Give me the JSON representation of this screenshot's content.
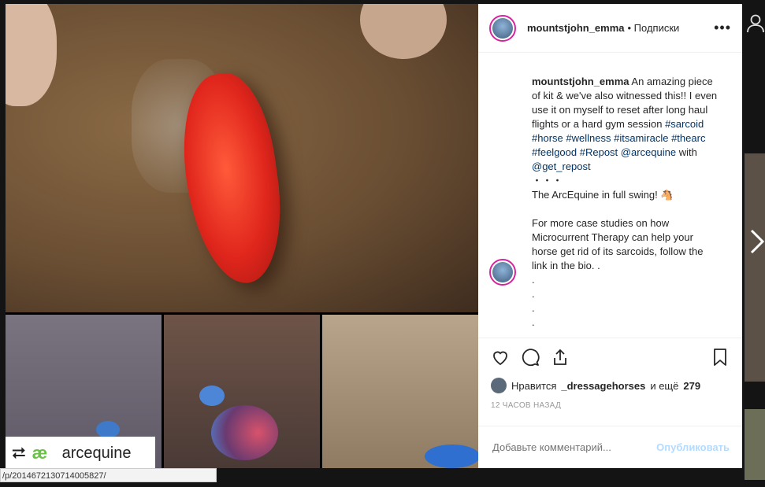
{
  "post": {
    "username": "mountstjohn_emma",
    "follow_label": "• Подписки",
    "more_label": "•••",
    "caption_user": "mountstjohn_emma",
    "caption_parts": [
      {
        "t": "text",
        "v": " An amazing piece of kit & we've also witnessed this!! I even use it on myself to reset after long haul flights or a hard gym session "
      },
      {
        "t": "tag",
        "v": "#sarcoid"
      },
      {
        "t": "text",
        "v": " "
      },
      {
        "t": "tag",
        "v": "#horse"
      },
      {
        "t": "text",
        "v": " "
      },
      {
        "t": "tag",
        "v": "#wellness"
      },
      {
        "t": "text",
        "v": " "
      },
      {
        "t": "tag",
        "v": "#itsamiracle"
      },
      {
        "t": "text",
        "v": " "
      },
      {
        "t": "tag",
        "v": "#thearc"
      },
      {
        "t": "text",
        "v": " "
      },
      {
        "t": "tag",
        "v": "#feelgood"
      },
      {
        "t": "text",
        "v": " "
      },
      {
        "t": "tag",
        "v": "#Repost"
      },
      {
        "t": "text",
        "v": " "
      },
      {
        "t": "tag",
        "v": "@arcequine"
      },
      {
        "t": "text",
        "v": " with "
      },
      {
        "t": "tag",
        "v": "@get_repost"
      }
    ],
    "caption_lines": [
      "・・・",
      "The ArcEquine in full swing! 🐴",
      "",
      "For more case studies on how Microcurrent Therapy can help your horse get rid of its sarcoids, follow the link in the bio. .",
      ".",
      ".",
      ".",
      "."
    ],
    "likes_prefix": "Нравится",
    "likes_user": "_dressagehorses",
    "likes_suffix": "и ещё",
    "likes_count": "279",
    "time_ago": "12 ЧАСОВ НАЗАД",
    "comment_placeholder": "Добавьте комментарий...",
    "post_button": "Опубликовать"
  },
  "watermark": {
    "repost_icon": "repost-icon",
    "logo_text": "æ",
    "logo_sub": "ARCEQUINE",
    "name": "arcequine"
  },
  "status_url": "/p/2014672130714005827/",
  "icons": [
    "heart-icon",
    "comment-icon",
    "share-icon",
    "bookmark-icon",
    "next-arrow-icon",
    "more-icon"
  ],
  "colors": {
    "accent_link": "#003569",
    "post_button": "#b3dbff",
    "lesion": "#e0261c"
  }
}
